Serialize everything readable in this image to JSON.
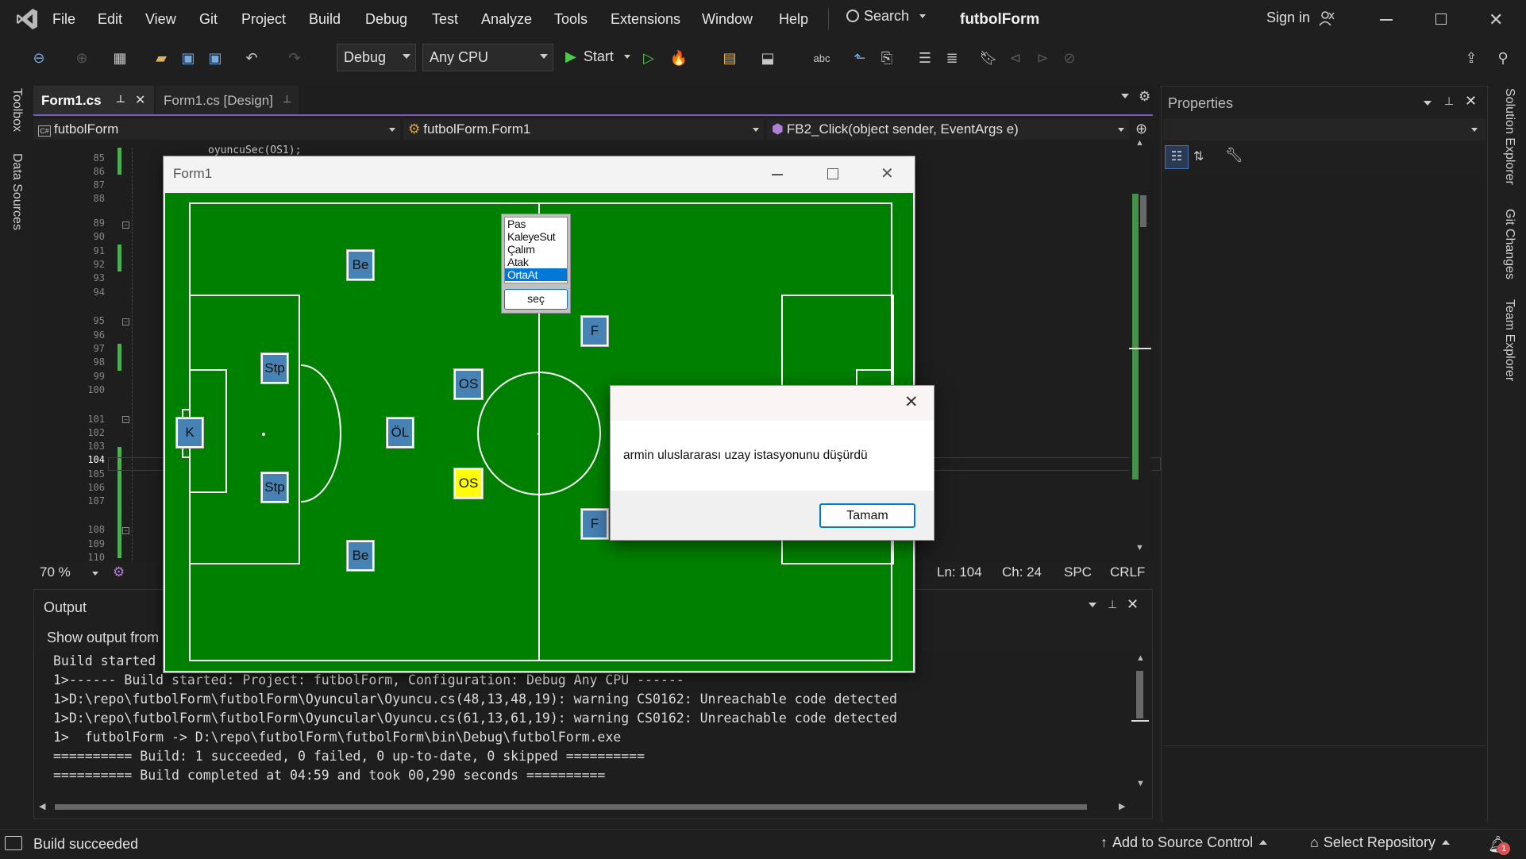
{
  "app": {
    "title": "futbolForm",
    "menu": [
      "File",
      "Edit",
      "View",
      "Git",
      "Project",
      "Build",
      "Debug",
      "Test",
      "Analyze",
      "Tools",
      "Extensions",
      "Window",
      "Help"
    ],
    "search_label": "Search",
    "sign_in": "Sign in"
  },
  "toolbar": {
    "config": "Debug",
    "platform": "Any CPU",
    "start_label": "Start"
  },
  "left_rail": {
    "items": [
      "Toolbox",
      "Data Sources"
    ]
  },
  "right_rail": {
    "items": [
      "Solution Explorer",
      "Git Changes",
      "Team Explorer"
    ]
  },
  "editor": {
    "tabs": [
      {
        "label": "Form1.cs",
        "active": true
      },
      {
        "label": "Form1.cs [Design]",
        "active": false
      }
    ],
    "nav": {
      "project": "futbolForm",
      "class": "futbolForm.Form1",
      "member": "FB2_Click(object sender, EventArgs e)"
    },
    "line_numbers": [
      "85",
      "86",
      "87",
      "88",
      "89",
      "90",
      "91",
      "92",
      "93",
      "94",
      "95",
      "96",
      "97",
      "98",
      "99",
      "100",
      "101",
      "102",
      "103",
      "104",
      "105",
      "106",
      "107",
      "108",
      "109",
      "110"
    ],
    "partial_code": "oyuncuSec(OS1);",
    "zoom": "70 %",
    "cursor": {
      "line": "Ln: 104",
      "col": "Ch: 24",
      "indent": "SPC",
      "eol": "CRLF"
    }
  },
  "output": {
    "title": "Output",
    "show_from": "Show output from",
    "lines": [
      "Build started",
      "1>------ Build started: Project: futbolForm, Configuration: Debug Any CPU ------",
      "1>D:\\repo\\futbolForm\\futbolForm\\Oyuncular\\Oyuncu.cs(48,13,48,19): warning CS0162: Unreachable code detected",
      "1>D:\\repo\\futbolForm\\futbolForm\\Oyuncular\\Oyuncu.cs(61,13,61,19): warning CS0162: Unreachable code detected",
      "1>  futbolForm -> D:\\repo\\futbolForm\\futbolForm\\bin\\Debug\\futbolForm.exe",
      "========== Build: 1 succeeded, 0 failed, 0 up-to-date, 0 skipped ==========",
      "========== Build completed at 04:59 and took 00,290 seconds =========="
    ]
  },
  "properties": {
    "title": "Properties"
  },
  "statusbar": {
    "left": "Build succeeded",
    "source_control": "Add to Source Control",
    "repo": "Select Repository",
    "notifications": "1"
  },
  "form1": {
    "title": "Form1",
    "actions": {
      "options": [
        "Pas",
        "KaleyeSut",
        "Çalım",
        "Atak",
        "OrtaAt"
      ],
      "selected": "OrtaAt",
      "button": "seç"
    },
    "players": {
      "gk": "K",
      "stp_top": "Stp",
      "stp_bottom": "Stp",
      "be_top": "Be",
      "be_bottom": "Be",
      "ol": "ÖL",
      "os_top": "OS",
      "os_bottom": "OS",
      "f_top": "F",
      "f_bottom": "F"
    },
    "colors": {
      "pitch": "#008000",
      "player": "#4682b4",
      "selected_player": "#ffff00"
    }
  },
  "dialog": {
    "message": "armin uluslararası uzay istasyonunu düşürdü",
    "ok": "Tamam"
  }
}
